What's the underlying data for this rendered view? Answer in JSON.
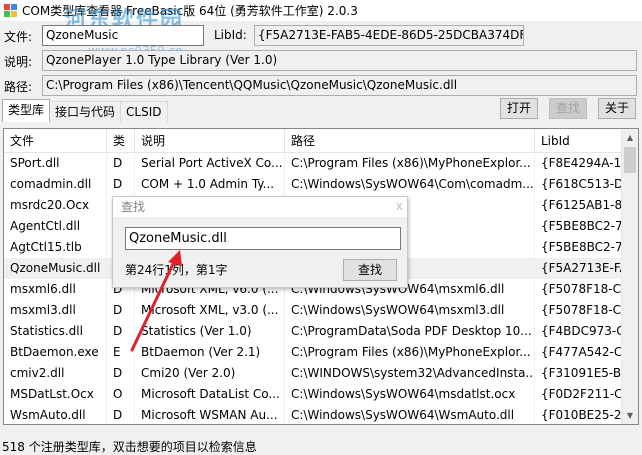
{
  "window": {
    "title": "COM类型库查看器 FreeBasic版 64位 (勇芳软件工作室) 2.0.3",
    "watermark": "河东软件园",
    "watermark_url": "www.pc0359.cn"
  },
  "form": {
    "file_label": "文件:",
    "file_value": "QzoneMusic",
    "libid_label": "LibId:",
    "libid_value": "{F5A2713E-FAB5-4EDE-86D5-25DCBA374DFE}",
    "desc_label": "说明:",
    "desc_value": "QzonePlayer 1.0 Type Library (Ver 1.0)",
    "path_label": "路径:",
    "path_value": "C:\\Program Files (x86)\\Tencent\\QQMusic\\QzoneMusic\\QzoneMusic.dll"
  },
  "tabs": [
    {
      "label": "类型库"
    },
    {
      "label": "接口与代码"
    },
    {
      "label": "CLSID"
    }
  ],
  "toolbar": {
    "open_label": "打开",
    "find_label": "查找",
    "about_label": "关于"
  },
  "list": {
    "columns": [
      "文件",
      "类",
      "说明",
      "路径",
      "LibId"
    ],
    "rows": [
      {
        "file": "SPort.dll",
        "type": "D",
        "desc": "Serial Port ActiveX Co...",
        "path": "C:\\Program Files (x86)\\MyPhoneExplor...",
        "libid": "{F8E4294A-18"
      },
      {
        "file": "comadmin.dll",
        "type": "D",
        "desc": "COM + 1.0 Admin Ty...",
        "path": "C:\\Windows\\SysWOW64\\Com\\comadm...",
        "libid": "{F618C513-D"
      },
      {
        "file": "msrdc20.Ocx",
        "type": "O",
        "desc": "",
        "path": "ow64\\msrdc20.Ocx",
        "libid": "{F6125AB1-8"
      },
      {
        "file": "AgentCtl.dll",
        "type": "D",
        "desc": "",
        "path": "ent\\AgentCtl.dll",
        "libid": "{F5BE8BC2-7"
      },
      {
        "file": "AgtCtl15.tlb",
        "type": "T",
        "desc": "",
        "path": "ent\\AgtCtl15.tlb",
        "libid": "{F5BE8BC2-7"
      },
      {
        "file": "QzoneMusic.dll",
        "type": "D",
        "desc": "",
        "path": ")\\Tencent\\QQMusi...",
        "libid": "{F5A2713E-FA"
      },
      {
        "file": "msxml6.dll",
        "type": "D",
        "desc": "Microsoft XML, v6.0 (...",
        "path": "C:\\Windows\\SysWOW64\\msxml6.dll",
        "libid": "{F5078F18-C5"
      },
      {
        "file": "msxml3.dll",
        "type": "D",
        "desc": "Microsoft XML, v3.0 (...",
        "path": "C:\\Windows\\SysWOW64\\msxml3.dll",
        "libid": "{F5078F18-C5"
      },
      {
        "file": "Statistics.dll",
        "type": "D",
        "desc": "Statistics (Ver 1.0)",
        "path": "C:\\ProgramData\\Soda PDF Desktop 10...",
        "libid": "{F4BDC973-C"
      },
      {
        "file": "BtDaemon.exe",
        "type": "E",
        "desc": "BtDaemon (Ver 2.1)",
        "path": "C:\\Program Files (x86)\\MyPhoneExplor...",
        "libid": "{F477A542-C"
      },
      {
        "file": "cmiv2.dll",
        "type": "D",
        "desc": "Cmi20 (Ver 2.0)",
        "path": "C:\\WINDOWS\\system32\\AdvancedInsta...",
        "libid": "{F31091E5-B0"
      },
      {
        "file": "MSDatLst.Ocx",
        "type": "O",
        "desc": "Microsoft DataList Co...",
        "path": "C:\\Windows\\SysWOW64\\msdatlst.ocx",
        "libid": "{F0D2F211-C"
      },
      {
        "file": "WsmAuto.dll",
        "type": "D",
        "desc": "Microsoft WSMAN Au...",
        "path": "C:\\Windows\\SysWOW64\\WsmAuto.dll",
        "libid": "{F010BE25-29"
      }
    ]
  },
  "find_dialog": {
    "title": "查找",
    "close_glyph": "x",
    "input_value": "QzoneMusic.dll",
    "status": "第24行1列，第1字",
    "button_label": "查找"
  },
  "statusbar": {
    "text": "518 个注册类型库，双击想要的项目以检索信息"
  },
  "colors": {
    "arrow": "#e0202a",
    "selected_row": "#f0f0f0",
    "disabled_text": "#a0a0a0"
  }
}
